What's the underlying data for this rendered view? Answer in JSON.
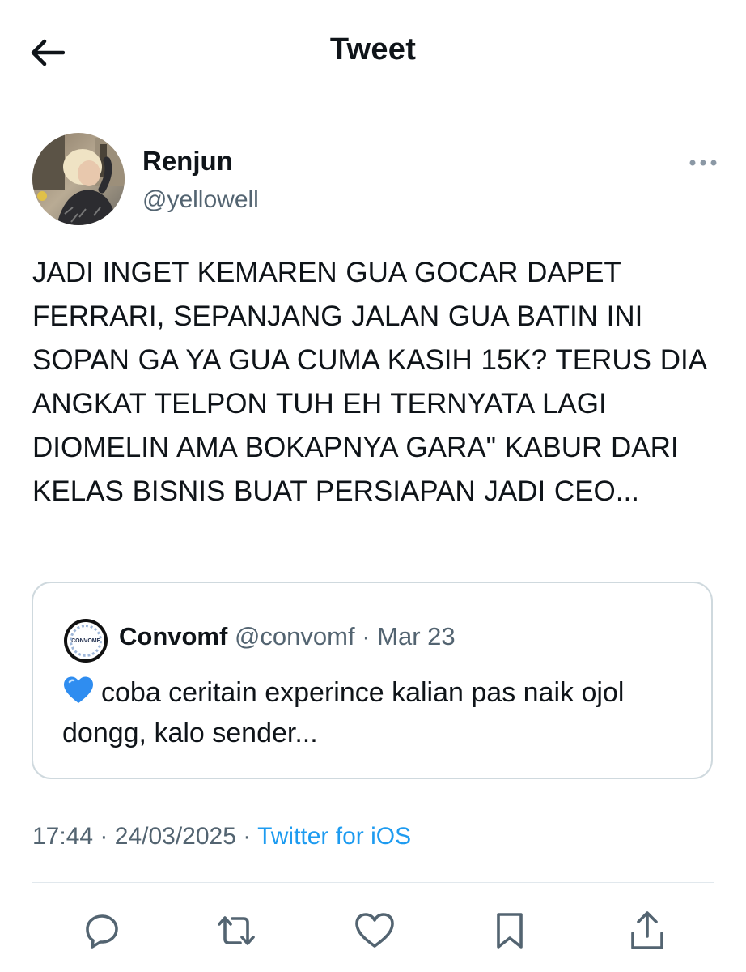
{
  "header": {
    "title": "Tweet",
    "back_icon": "arrow-left-icon"
  },
  "author": {
    "name": "Renjun",
    "handle": "@yellowell",
    "avatar": "profile-photo"
  },
  "tweet": {
    "text": "JADI INGET KEMAREN GUA GOCAR DAPET FERRARI, SEPANJANG JALAN GUA BATIN INI SOPAN GA YA GUA CUMA KASIH 15K? TERUS DIA ANGKAT TELPON TUH EH TERNYATA LAGI DIOMELIN AMA BOKAPNYA GARA\" KABUR DARI KELAS BISNIS BUAT PERSIAPAN JADI CEO...",
    "time": "17:44",
    "separator": "·",
    "date": "24/03/2025",
    "source": "Twitter for iOS"
  },
  "quote": {
    "avatar_text": "CONVOMF",
    "name": "Convomf",
    "handle": "@convomf",
    "separator": "·",
    "date": "Mar 23",
    "emoji": "blue-heart-icon",
    "text": "coba ceritain experince kalian pas naik ojol dongg, kalo sender..."
  },
  "actions": [
    "reply-icon",
    "retweet-icon",
    "like-icon",
    "bookmark-icon",
    "share-icon"
  ],
  "colors": {
    "text": "#0f1419",
    "secondary": "#536471",
    "link": "#1d9bf0",
    "border": "#cfd9de"
  }
}
